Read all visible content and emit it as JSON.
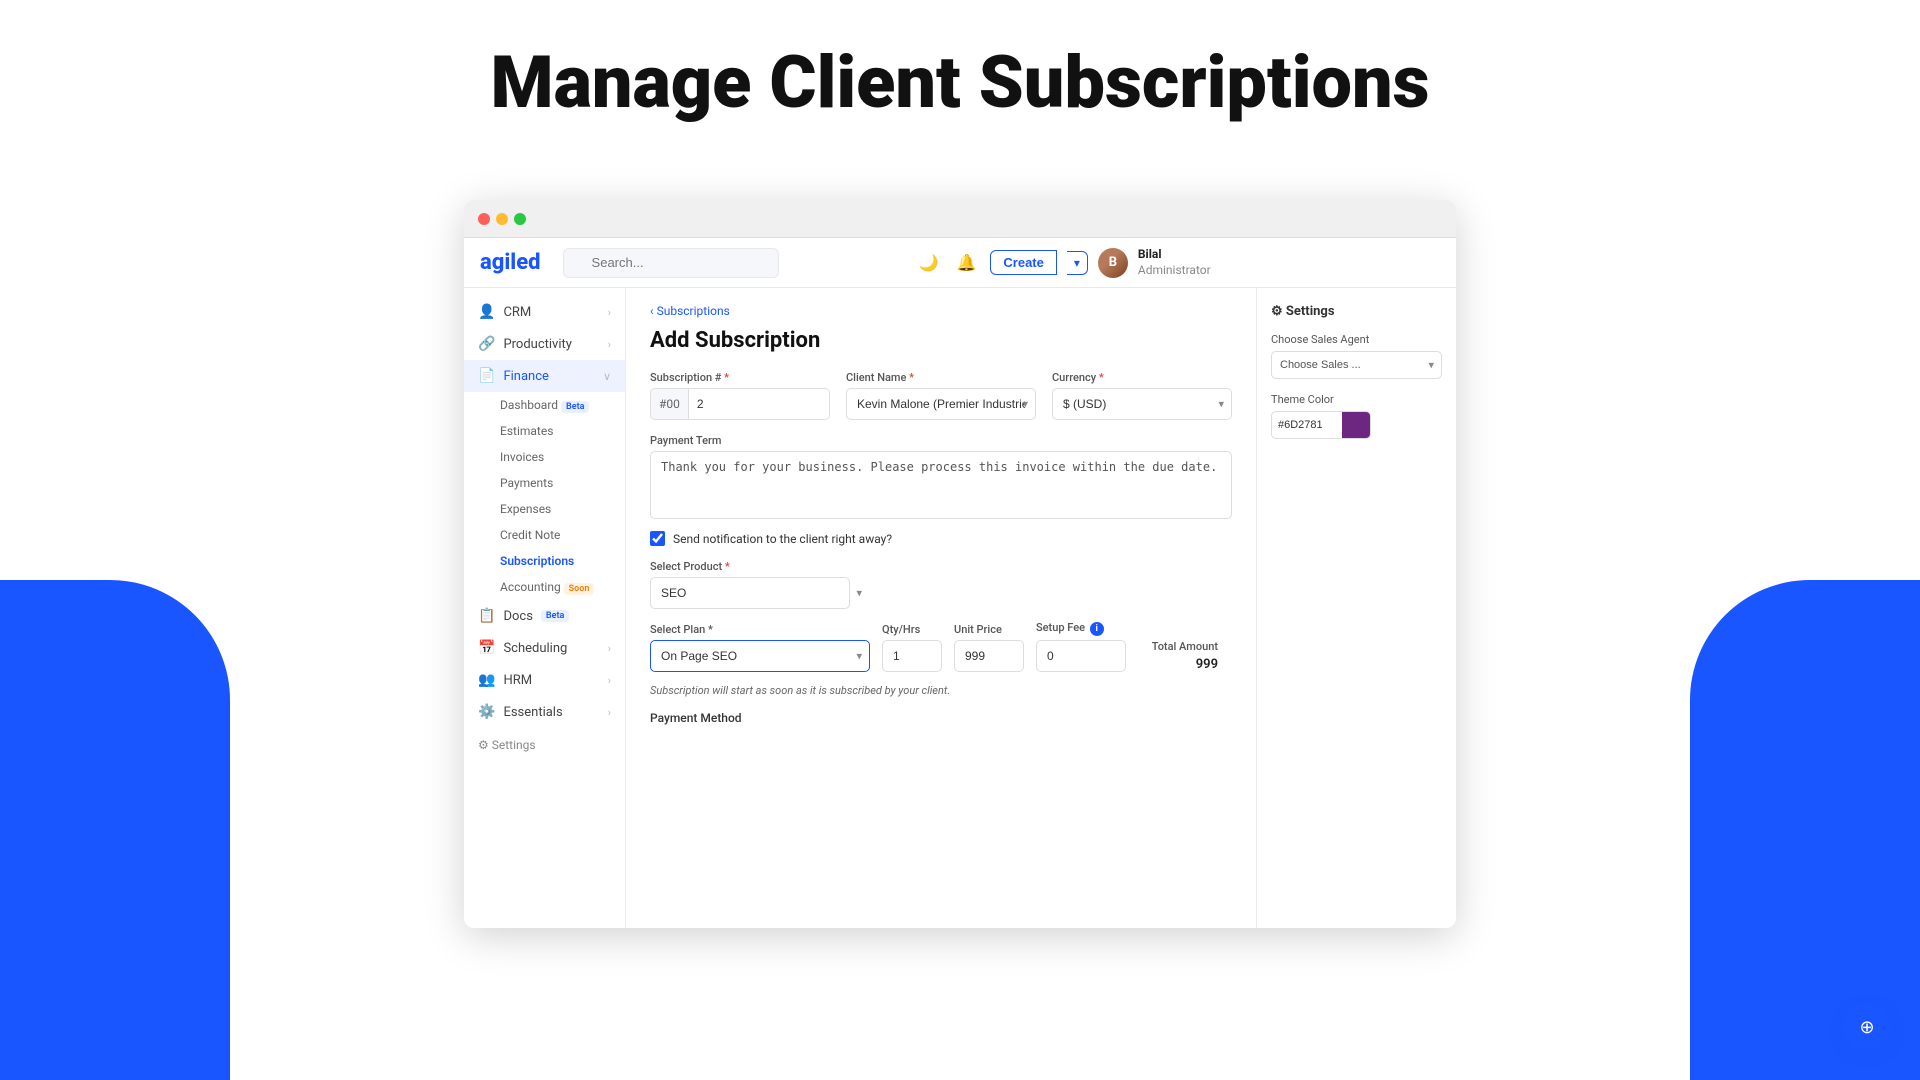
{
  "page": {
    "heading": "Manage Client Subscriptions"
  },
  "browser": {
    "logo": "agiled",
    "search_placeholder": "Search...",
    "create_label": "Create",
    "user": {
      "name": "Bilal",
      "role": "Administrator",
      "initials": "B"
    }
  },
  "sidebar": {
    "items": [
      {
        "id": "crm",
        "label": "CRM",
        "icon": "👤",
        "has_arrow": true
      },
      {
        "id": "productivity",
        "label": "Productivity",
        "icon": "🔗",
        "has_arrow": true
      },
      {
        "id": "finance",
        "label": "Finance",
        "icon": "📄",
        "has_arrow": false,
        "active": true,
        "expanded": true
      },
      {
        "id": "docs",
        "label": "Docs",
        "icon": "📋",
        "badge": "Beta",
        "badge_type": "beta"
      },
      {
        "id": "scheduling",
        "label": "Scheduling",
        "icon": "📅",
        "has_arrow": true
      },
      {
        "id": "hrm",
        "label": "HRM",
        "icon": "👥",
        "has_arrow": true
      },
      {
        "id": "essentials",
        "label": "Essentials",
        "icon": "⚙️",
        "has_arrow": true
      }
    ],
    "finance_subitems": [
      {
        "id": "dashboard",
        "label": "Dashboard",
        "badge": "Beta",
        "badge_type": "beta"
      },
      {
        "id": "estimates",
        "label": "Estimates"
      },
      {
        "id": "invoices",
        "label": "Invoices"
      },
      {
        "id": "payments",
        "label": "Payments"
      },
      {
        "id": "expenses",
        "label": "Expenses"
      },
      {
        "id": "credit-note",
        "label": "Credit Note"
      },
      {
        "id": "subscriptions",
        "label": "Subscriptions",
        "active": true
      },
      {
        "id": "accounting",
        "label": "Accounting",
        "badge": "Soon",
        "badge_type": "soon"
      }
    ],
    "settings_label": "⚙ Settings"
  },
  "breadcrumb": "Subscriptions",
  "form": {
    "title": "Add Subscription",
    "subscription_num_prefix": "#00",
    "subscription_num_value": "2",
    "subscription_num_label": "Subscription #",
    "client_name_label": "Client Name",
    "client_name_value": "Kevin Malone (Premier Industries)",
    "currency_label": "Currency",
    "currency_value": "$ (USD)",
    "payment_term_label": "Payment Term",
    "payment_term_value": "Thank you for your business. Please process this invoice within the due date.",
    "notification_label": "Send notification to the client right away?",
    "notification_checked": true,
    "select_product_label": "Select Product",
    "select_product_value": "SEO",
    "select_plan_label": "Select Plan",
    "select_plan_value": "On Page SEO",
    "qty_label": "Qty/Hrs",
    "qty_value": "1",
    "unit_price_label": "Unit Price",
    "unit_price_value": "999",
    "setup_fee_label": "Setup Fee",
    "setup_fee_value": "0",
    "total_amount_label": "Total Amount",
    "total_amount_value": "999",
    "subscription_note": "Subscription will start as soon as it is subscribed by your client.",
    "payment_method_label": "Payment Method"
  },
  "settings_panel": {
    "title": "⚙ Settings",
    "sales_agent_label": "Choose Sales Agent",
    "sales_agent_placeholder": "Choose Sales ...",
    "theme_color_label": "Theme Color",
    "theme_color_value": "#6D2781",
    "theme_color_swatch": "#6D2781"
  },
  "float_btn": {
    "icon": "⊕"
  }
}
